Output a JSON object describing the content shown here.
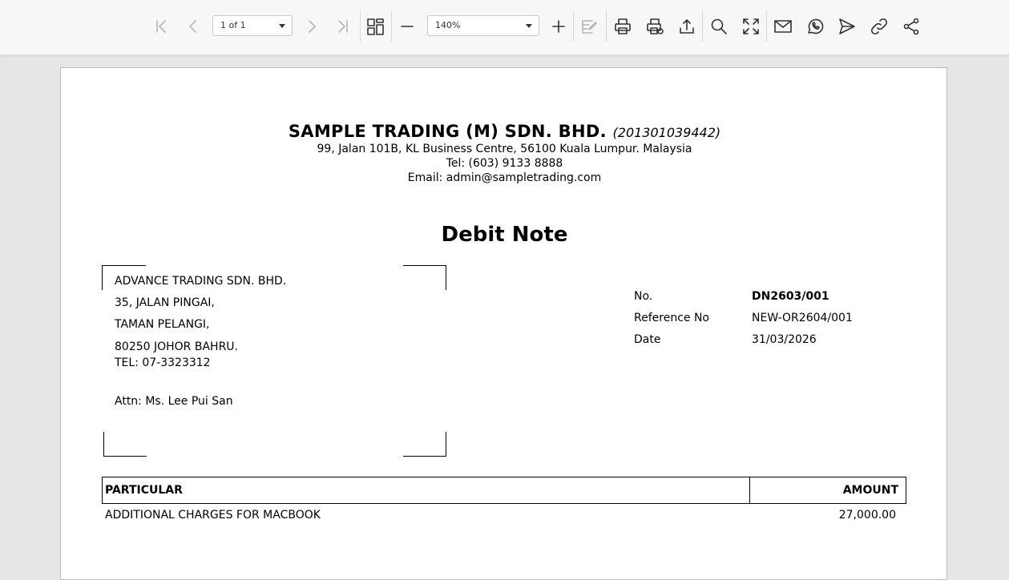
{
  "toolbar": {
    "page_select": "1 of 1",
    "zoom_select": "140%"
  },
  "document": {
    "company_name": "SAMPLE TRADING (M) SDN. BHD.",
    "company_reg": "(201301039442)",
    "address": "99, Jalan 101B, KL Business Centre, 56100 Kuala Lumpur. Malaysia",
    "tel": "Tel: (603) 9133 8888",
    "email": "Email: admin@sampletrading.com",
    "title": "Debit Note",
    "bill_to": {
      "line1": "ADVANCE TRADING SDN. BHD.",
      "line2": "35, JALAN PINGAI,",
      "line3": "TAMAN PELANGI,",
      "line4": "80250 JOHOR BAHRU.",
      "tel": "TEL: 07-3323312",
      "attn": "Attn: Ms. Lee Pui San"
    },
    "meta": {
      "no_label": "No.",
      "no_value": "DN2603/001",
      "ref_label": "Reference No",
      "ref_value": "NEW-OR2604/001",
      "date_label": "Date",
      "date_value": "31/03/2026"
    },
    "table": {
      "col_particular": "PARTICULAR",
      "col_amount": "AMOUNT",
      "rows": [
        {
          "particular": "ADDITIONAL CHARGES FOR MACBOOK",
          "amount": "27,000.00"
        }
      ]
    }
  }
}
